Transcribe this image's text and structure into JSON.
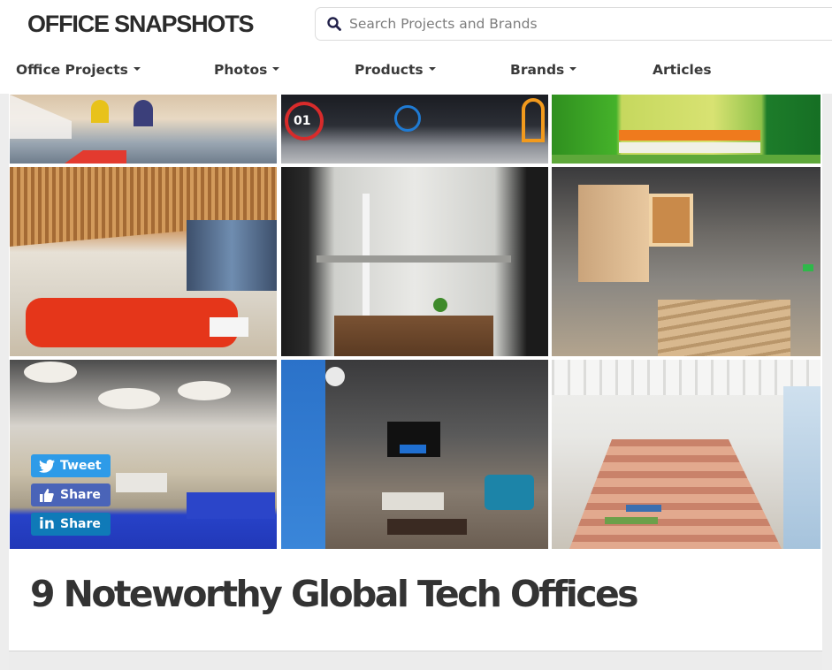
{
  "header": {
    "logo": "OFFICE SNAPSHOTS",
    "search": {
      "placeholder": "Search Projects and Brands",
      "value": "",
      "icon": "search-icon"
    }
  },
  "nav": {
    "items": [
      {
        "label": "Office Projects",
        "dropdown": true
      },
      {
        "label": "Photos",
        "dropdown": true
      },
      {
        "label": "Products",
        "dropdown": true
      },
      {
        "label": "Brands",
        "dropdown": true
      },
      {
        "label": "Articles",
        "dropdown": false
      }
    ]
  },
  "gallery": {
    "photos": [
      {
        "alt": "Bright atrium workspace with yellow doorway and seating"
      },
      {
        "alt": "Dark lobby with red and blue number graphics"
      },
      {
        "alt": "Green curtained room with orange stripe floor"
      },
      {
        "alt": "Slatted wood ceiling lounge with red sofa"
      },
      {
        "alt": "Multi-level atrium with bridge and white columns"
      },
      {
        "alt": "Industrial atrium with wooden box meeting rooms"
      },
      {
        "alt": "Open lounge with pendant lights and blue sofas"
      },
      {
        "alt": "Splunk lobby with lounge chairs and coffee table"
      },
      {
        "alt": "White warehouse with wooden bleacher stairs"
      }
    ]
  },
  "share": {
    "tweet": "Tweet",
    "facebook": "Share",
    "linkedin": "Share"
  },
  "article": {
    "title": "9 Noteworthy Global Tech Offices"
  }
}
